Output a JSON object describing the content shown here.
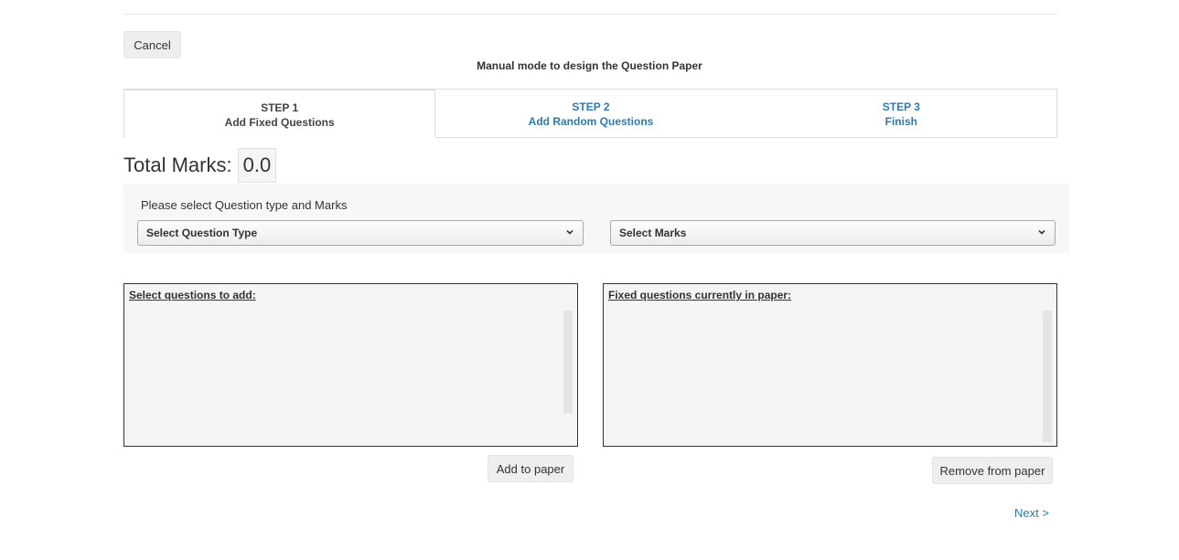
{
  "cancel_label": "Cancel",
  "page_heading": "Manual mode to design the Question Paper",
  "steps": [
    {
      "number": "STEP 1",
      "label": "Add Fixed Questions",
      "active": true
    },
    {
      "number": "STEP 2",
      "label": "Add Random Questions",
      "active": false
    },
    {
      "number": "STEP 3",
      "label": "Finish",
      "active": false
    }
  ],
  "total_marks": {
    "label": "Total Marks:",
    "value": "0.0"
  },
  "filters": {
    "prompt": "Please select Question type and Marks",
    "question_type": {
      "selected": "Select Question Type"
    },
    "marks": {
      "selected": "Select Marks"
    }
  },
  "available_questions": {
    "title": "Select questions to add:",
    "items": []
  },
  "fixed_questions": {
    "title": "Fixed questions currently in paper:",
    "items": []
  },
  "add_label": "Add to paper",
  "remove_label": "Remove from paper",
  "next_label": "Next >",
  "colors": {
    "link": "#2a7ab8",
    "button_bg": "#eeeeee",
    "panel_bg": "#f7f7f7"
  },
  "icons": {
    "select_arrow": "chevron-down-icon"
  }
}
